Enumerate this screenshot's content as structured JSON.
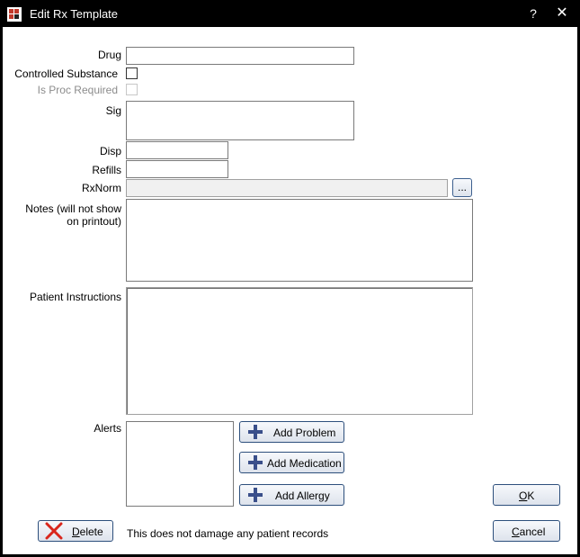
{
  "window": {
    "title": "Edit Rx Template",
    "help_glyph": "?",
    "close_glyph": "✕"
  },
  "labels": {
    "drug": "Drug",
    "controlled_substance": "Controlled Substance",
    "is_proc_required": "Is Proc Required",
    "sig": "Sig",
    "disp": "Disp",
    "refills": "Refills",
    "rxnorm": "RxNorm",
    "notes_line1": "Notes (will not show",
    "notes_line2": "on printout)",
    "patient_instructions": "Patient Instructions",
    "alerts": "Alerts"
  },
  "fields": {
    "drug": "",
    "sig": "",
    "disp": "",
    "refills": "",
    "rxnorm": "",
    "notes": "",
    "patient_instructions": ""
  },
  "checkboxes": {
    "controlled_substance": false,
    "is_proc_required": false
  },
  "buttons": {
    "rxnorm_browse": "...",
    "add_problem": "Add Problem",
    "add_medication": "Add Medication",
    "add_allergy": "Add Allergy",
    "ok_letter": "O",
    "ok_rest": "K",
    "cancel_letter": "C",
    "cancel_rest": "ancel",
    "delete_letter": "D",
    "delete_rest": "elete"
  },
  "footer_note": "This does not damage any patient records",
  "colors": {
    "titlebar": "#000000",
    "delete_icon": "#d9261c",
    "plus_icon": "#3a4f8a",
    "button_border": "#2d4f7c"
  }
}
